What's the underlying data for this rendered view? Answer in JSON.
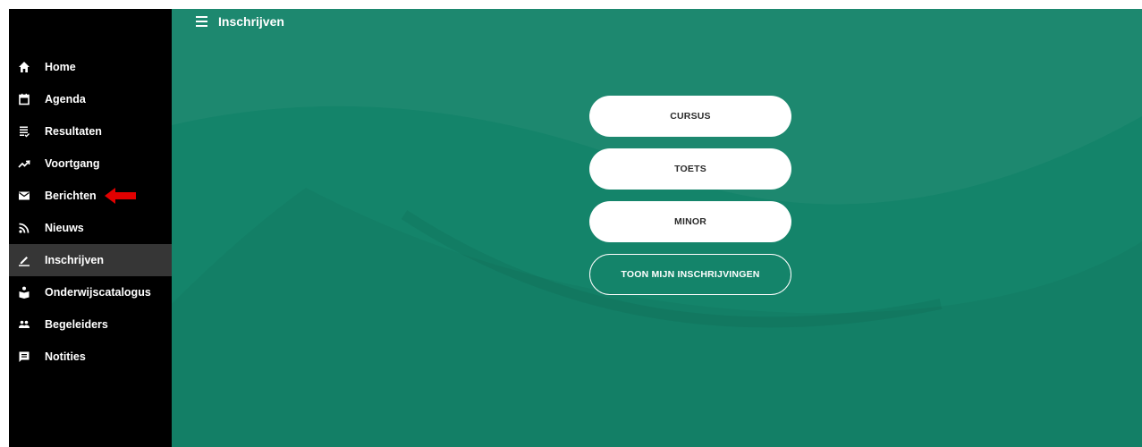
{
  "header": {
    "title": "Inschrijven"
  },
  "sidebar": {
    "items": [
      {
        "label": "Home",
        "icon": "home-icon"
      },
      {
        "label": "Agenda",
        "icon": "calendar-icon"
      },
      {
        "label": "Resultaten",
        "icon": "results-list-icon"
      },
      {
        "label": "Voortgang",
        "icon": "trending-up-icon"
      },
      {
        "label": "Berichten",
        "icon": "mail-icon"
      },
      {
        "label": "Nieuws",
        "icon": "rss-icon"
      },
      {
        "label": "Inschrijven",
        "icon": "pencil-icon",
        "active": true
      },
      {
        "label": "Onderwijscatalogus",
        "icon": "reader-icon"
      },
      {
        "label": "Begeleiders",
        "icon": "people-icon"
      },
      {
        "label": "Notities",
        "icon": "note-icon"
      }
    ]
  },
  "main": {
    "buttons": [
      {
        "label": "CURSUS",
        "style": "filled"
      },
      {
        "label": "TOETS",
        "style": "filled"
      },
      {
        "label": "MINOR",
        "style": "filled"
      },
      {
        "label": "TOON MIJN INSCHRIJVINGEN",
        "style": "outline"
      }
    ]
  },
  "annotation": {
    "icon": "red-arrow-left-icon",
    "color": "#e10000"
  },
  "colors": {
    "sidebar_bg": "#000000",
    "sidebar_active_bg": "#363636",
    "main_bg": "#14846a",
    "button_bg": "#ffffff"
  }
}
